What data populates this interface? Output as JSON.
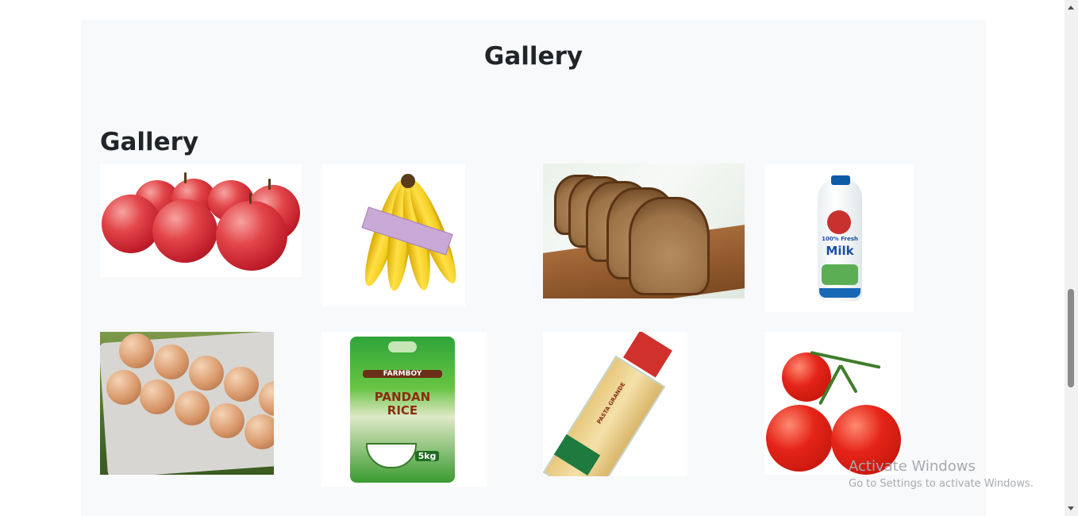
{
  "page": {
    "title": "Gallery"
  },
  "gallery": {
    "heading": "Gallery",
    "items": [
      {
        "name": "apples",
        "alt": "Apples"
      },
      {
        "name": "bananas",
        "alt": "Bananas"
      },
      {
        "name": "bread",
        "alt": "Bread"
      },
      {
        "name": "milk",
        "alt": "Milk",
        "label_top": "100% Fresh",
        "label_main": "Milk"
      },
      {
        "name": "eggs",
        "alt": "Eggs"
      },
      {
        "name": "rice",
        "alt": "Rice",
        "brand": "FARMBOY",
        "label_main": "PANDAN RICE",
        "weight": "5kg"
      },
      {
        "name": "pasta",
        "alt": "Pasta",
        "label": "PASTA GRANDE"
      },
      {
        "name": "tomatoes",
        "alt": "Tomatoes"
      }
    ]
  },
  "watermark": {
    "title": "Activate Windows",
    "subtitle": "Go to Settings to activate Windows."
  },
  "colors": {
    "panel_bg": "#f8f9fa",
    "heading_text": "#212529"
  }
}
